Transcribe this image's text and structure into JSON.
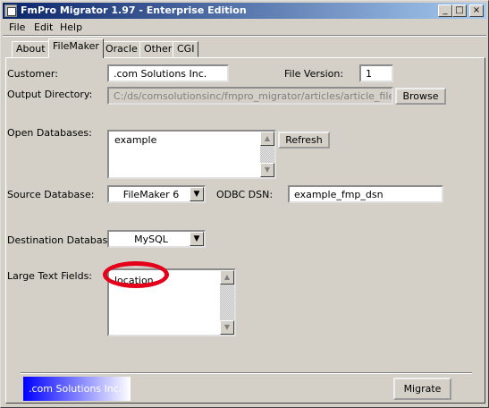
{
  "window": {
    "title": "FmPro Migrator 1.97 - Enterprise Edition",
    "minimize": "_",
    "maximize": "□",
    "close": "×"
  },
  "menu": [
    "File",
    "Edit",
    "Help"
  ],
  "tabs": [
    "About",
    "FileMaker",
    "Oracle",
    "Other",
    "CGI"
  ],
  "form": {
    "customer_label": "Customer:",
    "customer_value": ".com Solutions Inc.",
    "file_version_label": "File Version:",
    "file_version_value": "1",
    "output_dir_label": "Output Directory:",
    "output_dir_value": "C:/ds/comsolutionsinc/fmpro_migrator/articles/article_filemaker_t",
    "browse_label": "Browse",
    "open_db_label": "Open Databases:",
    "open_db_items": [
      "example"
    ],
    "refresh_label": "Refresh",
    "source_db_label": "Source Database:",
    "source_db_value": "FileMaker 6",
    "odbc_label": "ODBC DSN:",
    "odbc_value": "example_fmp_dsn",
    "dest_db_label": "Destination Database:",
    "dest_db_value": "MySQL",
    "large_text_label": "Large Text Fields:",
    "large_text_items": [
      "location"
    ]
  },
  "footer": {
    "brand": ".com Solutions Inc.",
    "migrate_label": "Migrate"
  },
  "colors": {
    "titlebar_start": "#0a246a",
    "highlight_ring": "#e4001b",
    "brand_blue": "#0000ff"
  }
}
